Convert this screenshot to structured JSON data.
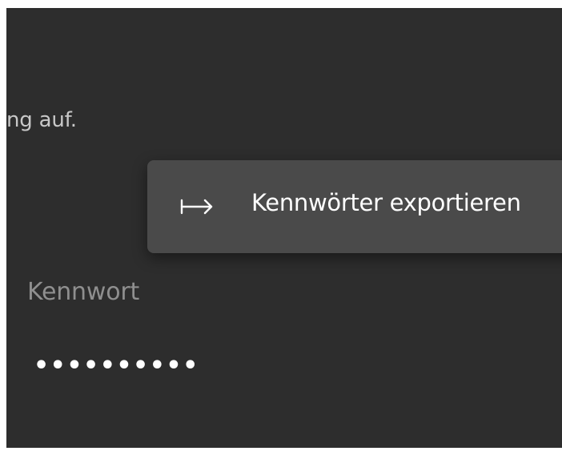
{
  "background": {
    "truncated_text": "ng auf."
  },
  "context_menu": {
    "items": [
      {
        "label": "Kennwörter exportieren",
        "icon": "export-arrow-icon"
      }
    ]
  },
  "credential": {
    "password_label": "Kennwort",
    "password_masked": "••••••••••"
  },
  "colors": {
    "background": "#2d2d2d",
    "menu_background": "#4a4a4a",
    "menu_text": "#ffffff",
    "label_text": "#8f8f8f",
    "body_text": "#c8c8c8"
  }
}
